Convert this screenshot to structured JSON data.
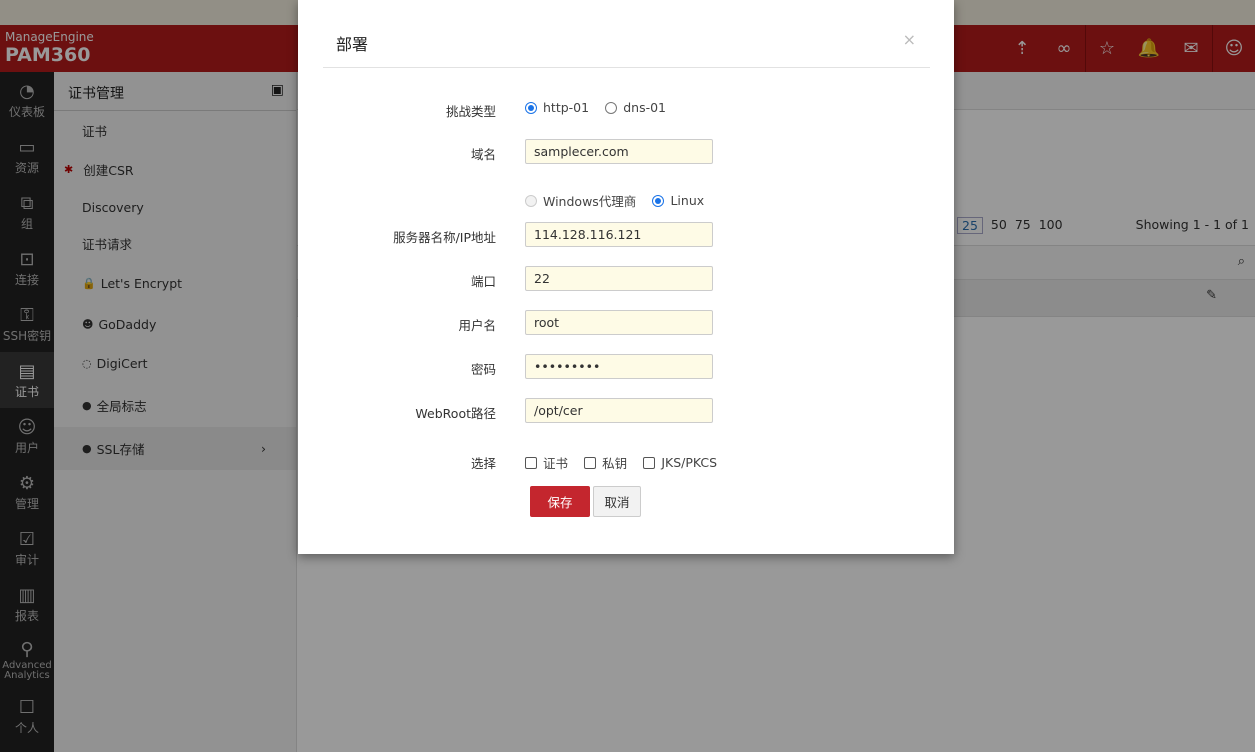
{
  "header": {
    "brand": "ManageEngine",
    "product": "PAM360"
  },
  "leftnav": [
    {
      "label": "仪表板",
      "icon": "dashboard-icon",
      "g": "◔"
    },
    {
      "label": "资源",
      "icon": "monitor-icon",
      "g": "▭"
    },
    {
      "label": "组",
      "icon": "group-icon",
      "g": "⧉"
    },
    {
      "label": "连接",
      "icon": "connection-icon",
      "g": "⊡"
    },
    {
      "label": "SSH密钥",
      "icon": "ssh-key-icon",
      "g": "⚿"
    },
    {
      "label": "证书",
      "icon": "certificate-icon",
      "g": "▤"
    },
    {
      "label": "用户",
      "icon": "user-icon",
      "g": "☺"
    },
    {
      "label": "管理",
      "icon": "gear-icon",
      "g": "⚙"
    },
    {
      "label": "审计",
      "icon": "audit-icon",
      "g": "☑"
    },
    {
      "label": "报表",
      "icon": "report-icon",
      "g": "▥"
    },
    {
      "label": "Advanced Analytics",
      "icon": "analytics-icon",
      "g": "⚲"
    },
    {
      "label": "个人",
      "icon": "personal-icon",
      "g": "☐"
    }
  ],
  "subnav": {
    "title": "证书管理",
    "items": [
      {
        "label": "证书",
        "g": ""
      },
      {
        "label": "创建CSR",
        "g": "✱"
      },
      {
        "label": "Discovery",
        "g": ""
      },
      {
        "label": "证书请求",
        "g": ""
      },
      {
        "label": "Let's Encrypt",
        "g": "🔒"
      },
      {
        "label": "GoDaddy",
        "g": "☻"
      },
      {
        "label": "DigiCert",
        "g": "◌"
      },
      {
        "label": "全局标志",
        "g": "●"
      },
      {
        "label": "SSL存储",
        "g": "●"
      }
    ]
  },
  "main": {
    "page_sizes": [
      "25",
      "50",
      "75",
      "100"
    ],
    "selected_page_size": "25",
    "showing": "Showing 1 - 1 of 1"
  },
  "modal": {
    "title": "部署",
    "close": "×",
    "challenge_label": "挑战类型",
    "challenge_options": [
      "http-01",
      "dns-01"
    ],
    "challenge_selected": "http-01",
    "domain_label": "域名",
    "domain": "samplecer.com",
    "os_options": [
      "Windows代理商",
      "Linux"
    ],
    "os_selected": "Linux",
    "server_label": "服务器名称/IP地址",
    "server": "114.128.116.121",
    "port_label": "端口",
    "port": "22",
    "user_label": "用户名",
    "user": "root",
    "password_label": "密码",
    "password": "•••••••••",
    "webroot_label": "WebRoot路径",
    "webroot": "/opt/cer",
    "select_label": "选择",
    "select_options": [
      "证书",
      "私钥",
      "JKS/PKCS"
    ],
    "save": "保存",
    "cancel": "取消"
  },
  "colors": {
    "header": "#b51c1c",
    "save": "#c4262e",
    "radio": "#1a73e8"
  }
}
